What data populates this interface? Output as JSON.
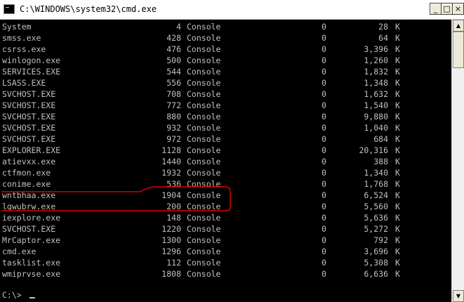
{
  "window": {
    "title": "C:\\WINDOWS\\system32\\cmd.exe",
    "minimize_label": "_",
    "maximize_label": "□",
    "close_label": "×"
  },
  "processes": [
    {
      "name": "System",
      "pid": "4",
      "session": "Console",
      "num": "0",
      "mem": "28",
      "unit": "K"
    },
    {
      "name": "smss.exe",
      "pid": "428",
      "session": "Console",
      "num": "0",
      "mem": "64",
      "unit": "K"
    },
    {
      "name": "csrss.exe",
      "pid": "476",
      "session": "Console",
      "num": "0",
      "mem": "3,396",
      "unit": "K"
    },
    {
      "name": "winlogon.exe",
      "pid": "500",
      "session": "Console",
      "num": "0",
      "mem": "1,260",
      "unit": "K"
    },
    {
      "name": "SERVICES.EXE",
      "pid": "544",
      "session": "Console",
      "num": "0",
      "mem": "1,832",
      "unit": "K"
    },
    {
      "name": "LSASS.EXE",
      "pid": "556",
      "session": "Console",
      "num": "0",
      "mem": "1,348",
      "unit": "K"
    },
    {
      "name": "SVCHOST.EXE",
      "pid": "708",
      "session": "Console",
      "num": "0",
      "mem": "1,632",
      "unit": "K"
    },
    {
      "name": "SVCHOST.EXE",
      "pid": "772",
      "session": "Console",
      "num": "0",
      "mem": "1,540",
      "unit": "K"
    },
    {
      "name": "SVCHOST.EXE",
      "pid": "880",
      "session": "Console",
      "num": "0",
      "mem": "9,880",
      "unit": "K"
    },
    {
      "name": "SVCHOST.EXE",
      "pid": "932",
      "session": "Console",
      "num": "0",
      "mem": "1,040",
      "unit": "K"
    },
    {
      "name": "SVCHOST.EXE",
      "pid": "972",
      "session": "Console",
      "num": "0",
      "mem": "684",
      "unit": "K"
    },
    {
      "name": "EXPLORER.EXE",
      "pid": "1128",
      "session": "Console",
      "num": "0",
      "mem": "20,316",
      "unit": "K"
    },
    {
      "name": "atievxx.exe",
      "pid": "1440",
      "session": "Console",
      "num": "0",
      "mem": "388",
      "unit": "K"
    },
    {
      "name": "ctfmon.exe",
      "pid": "1932",
      "session": "Console",
      "num": "0",
      "mem": "1,340",
      "unit": "K"
    },
    {
      "name": "conime.exe",
      "pid": "536",
      "session": "Console",
      "num": "0",
      "mem": "1,768",
      "unit": "K"
    },
    {
      "name": "wntbhaa.exe",
      "pid": "1904",
      "session": "Console",
      "num": "0",
      "mem": "6,524",
      "unit": "K"
    },
    {
      "name": "lgwubrw.exe",
      "pid": "200",
      "session": "Console",
      "num": "0",
      "mem": "5,560",
      "unit": "K"
    },
    {
      "name": "iexplore.exe",
      "pid": "148",
      "session": "Console",
      "num": "0",
      "mem": "5,636",
      "unit": "K"
    },
    {
      "name": "SVCHOST.EXE",
      "pid": "1220",
      "session": "Console",
      "num": "0",
      "mem": "5,272",
      "unit": "K"
    },
    {
      "name": "MrCaptor.exe",
      "pid": "1300",
      "session": "Console",
      "num": "0",
      "mem": "792",
      "unit": "K"
    },
    {
      "name": "cmd.exe",
      "pid": "1296",
      "session": "Console",
      "num": "0",
      "mem": "3,696",
      "unit": "K"
    },
    {
      "name": "tasklist.exe",
      "pid": "112",
      "session": "Console",
      "num": "0",
      "mem": "5,308",
      "unit": "K"
    },
    {
      "name": "wmiprvse.exe",
      "pid": "1808",
      "session": "Console",
      "num": "0",
      "mem": "6,636",
      "unit": "K"
    }
  ],
  "prompt": "C:\\>",
  "colors": {
    "console_bg": "#000000",
    "console_text": "#c0c0c0",
    "highlight": "#e00000"
  }
}
